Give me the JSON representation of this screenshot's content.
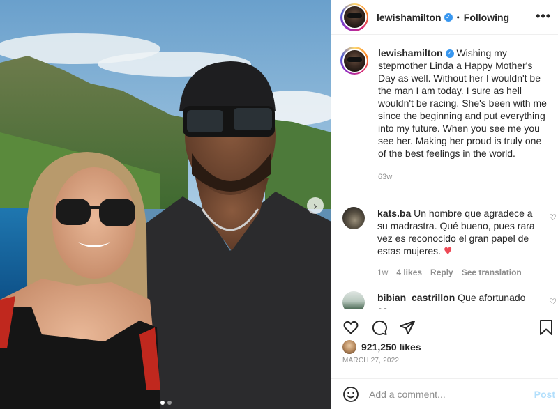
{
  "post": {
    "author": "lewishamilton",
    "follow_separator": "•",
    "follow_status": "Following",
    "more_icon": "•••",
    "verified_icon": "✓",
    "caption": "Wishing my stepmother Linda a Happy Mother's Day as well. Without her I wouldn't be the man I am today. I sure as hell wouldn't be racing. She's been with me since the beginning and put everything into my future. When you see me you see her. Making her proud is truly one of the best feelings in the world.",
    "caption_time": "63w",
    "likes": "921,250 likes",
    "date": "MARCH 27, 2022"
  },
  "carousel": {
    "next_icon": "›",
    "slide_count": 2,
    "active_slide": 1
  },
  "comments": [
    {
      "user": "kats.ba",
      "text": "Un hombre que agradece a su madrastra. Qué bueno, pues rara vez es reconocido el gran papel de estas mujeres.",
      "emoji": "♥",
      "time": "1w",
      "likes": "4 likes",
      "reply": "Reply",
      "translate": "See translation",
      "like_icon": "♡"
    },
    {
      "user": "bibian_castrillon",
      "text": "Que afortunado es",
      "like_icon": "♡"
    }
  ],
  "composer": {
    "placeholder": "Add a comment...",
    "post_label": "Post"
  },
  "colors": {
    "accent_link": "#b2dffc",
    "verified": "#3897f0",
    "heart": "#ed4956"
  },
  "icons": [
    "heart-icon",
    "comment-icon",
    "share-icon",
    "bookmark-icon",
    "emoji-icon",
    "more-icon",
    "verified-icon",
    "chevron-right-icon"
  ]
}
